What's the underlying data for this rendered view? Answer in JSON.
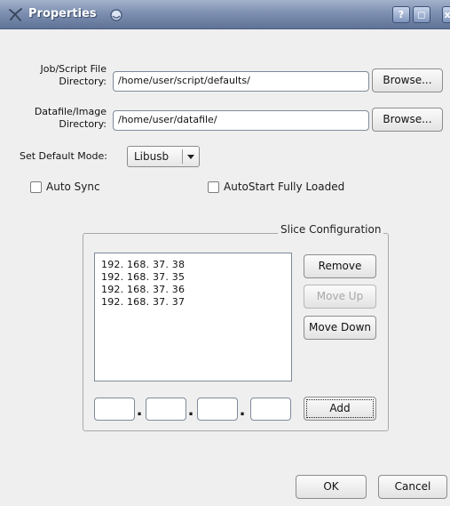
{
  "window": {
    "title": "Properties",
    "icons": {
      "app": "app-icon",
      "pin": "pin-icon",
      "help": "help-icon",
      "maximize": "maximize-icon",
      "close": "close-icon"
    },
    "help_glyph": "?",
    "maximize_glyph": "◻",
    "close_glyph": "x"
  },
  "job_dir": {
    "label_line1": "Job/Script File",
    "label_line2": "Directory:",
    "value": "/home/user/script/defaults/",
    "browse_label": "Browse..."
  },
  "data_dir": {
    "label_line1": "Datafile/Image",
    "label_line2": "Directory:",
    "value": "/home/user/datafile/",
    "browse_label": "Browse..."
  },
  "mode": {
    "label": "Set Default Mode:",
    "selected": "Libusb"
  },
  "options": {
    "auto_sync": {
      "label": "Auto Sync",
      "checked": false
    },
    "autostart": {
      "label": "AutoStart Fully Loaded",
      "checked": false
    }
  },
  "slice_config": {
    "title": "Slice Configuration",
    "items": [
      "192. 168. 37. 38",
      "192. 168. 37. 35",
      "192. 168. 37. 36",
      "192. 168. 37. 37"
    ],
    "remove_label": "Remove",
    "move_up_label": "Move Up",
    "move_down_label": "Move Down",
    "add_label": "Add",
    "ip_fields": [
      "",
      "",
      "",
      ""
    ],
    "ip_separator": "."
  },
  "footer": {
    "ok_label": "OK",
    "cancel_label": "Cancel"
  },
  "colors": {
    "titlebar": "#7d90b1",
    "dialog_bg": "#efefef"
  }
}
